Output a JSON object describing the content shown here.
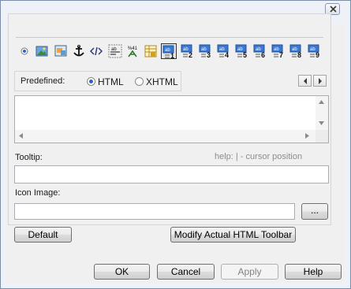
{
  "window": {
    "close_icon": "close-icon"
  },
  "toolbar": {
    "buttons": [
      {
        "name": "radio-tool-icon"
      },
      {
        "name": "image-tool-icon"
      },
      {
        "name": "image-map-tool-icon"
      },
      {
        "name": "anchor-tool-icon"
      },
      {
        "name": "html-tag-tool-icon"
      },
      {
        "name": "special-char-tool-icon"
      },
      {
        "name": "entity-tool-icon"
      },
      {
        "name": "lock-table-tool-icon"
      },
      {
        "name": "custom-toolbar-1-icon",
        "digit": "1",
        "selected": true
      },
      {
        "name": "custom-toolbar-2-icon",
        "digit": "2"
      },
      {
        "name": "custom-toolbar-3-icon",
        "digit": "3"
      },
      {
        "name": "custom-toolbar-4-icon",
        "digit": "4"
      },
      {
        "name": "custom-toolbar-5-icon",
        "digit": "5"
      },
      {
        "name": "custom-toolbar-6-icon",
        "digit": "6"
      },
      {
        "name": "custom-toolbar-7-icon",
        "digit": "7"
      },
      {
        "name": "custom-toolbar-8-icon",
        "digit": "8"
      },
      {
        "name": "custom-toolbar-9-icon",
        "digit": "9"
      }
    ],
    "icon_badge_text": "ab",
    "entity_badge_text": "%41"
  },
  "predefined": {
    "label": "Predefined:",
    "options": [
      "HTML",
      "XHTML"
    ],
    "selected": "HTML"
  },
  "editor": {
    "value": ""
  },
  "tooltip": {
    "label": "Tooltip:",
    "hint": "help: | - cursor position",
    "value": ""
  },
  "icon_image": {
    "label": "Icon Image:",
    "value": "",
    "browse_label": "..."
  },
  "actions": {
    "default_label": "Default",
    "modify_label": "Modify Actual HTML Toolbar"
  },
  "dialog_buttons": {
    "ok": "OK",
    "cancel": "Cancel",
    "apply": "Apply",
    "help": "Help"
  },
  "colors": {
    "accent": "#2a64c6",
    "frame": "#7b8ea8",
    "custom_icon_bg": "#3a78d4"
  }
}
